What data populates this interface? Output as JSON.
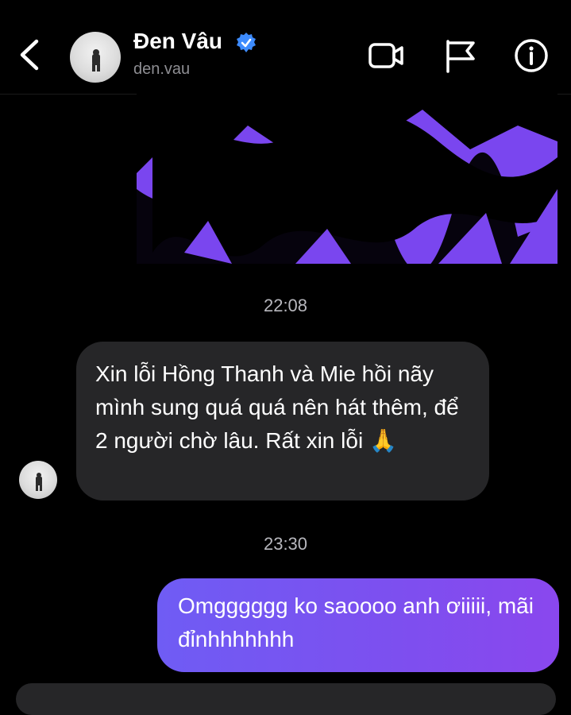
{
  "header": {
    "name": "Đen Vâu",
    "handle": "den.vau",
    "icons": [
      "back-chevron-icon",
      "avatar",
      "verified-badge-icon",
      "video-call-icon",
      "report-flag-icon",
      "info-icon"
    ]
  },
  "messages": [
    {
      "type": "timestamp",
      "text": "22:08"
    },
    {
      "type": "incoming",
      "text": "Xin lỗi Hồng Thanh và Mie hồi nãy mình sung quá quá nên hát thêm, để 2 người chờ lâu. Rất xin lỗi 🙏"
    },
    {
      "type": "timestamp",
      "text": "23:30"
    },
    {
      "type": "outgoing",
      "text": "Omgggggg ko saoooo anh ơiiiii, mãi đỉnhhhhhhh"
    }
  ],
  "colors": {
    "background": "#000000",
    "incoming_bubble": "#262628",
    "outgoing_bubble": "#7b4ff0",
    "verified": "#3d8bfd",
    "timestamp": "#b7b7bd"
  }
}
